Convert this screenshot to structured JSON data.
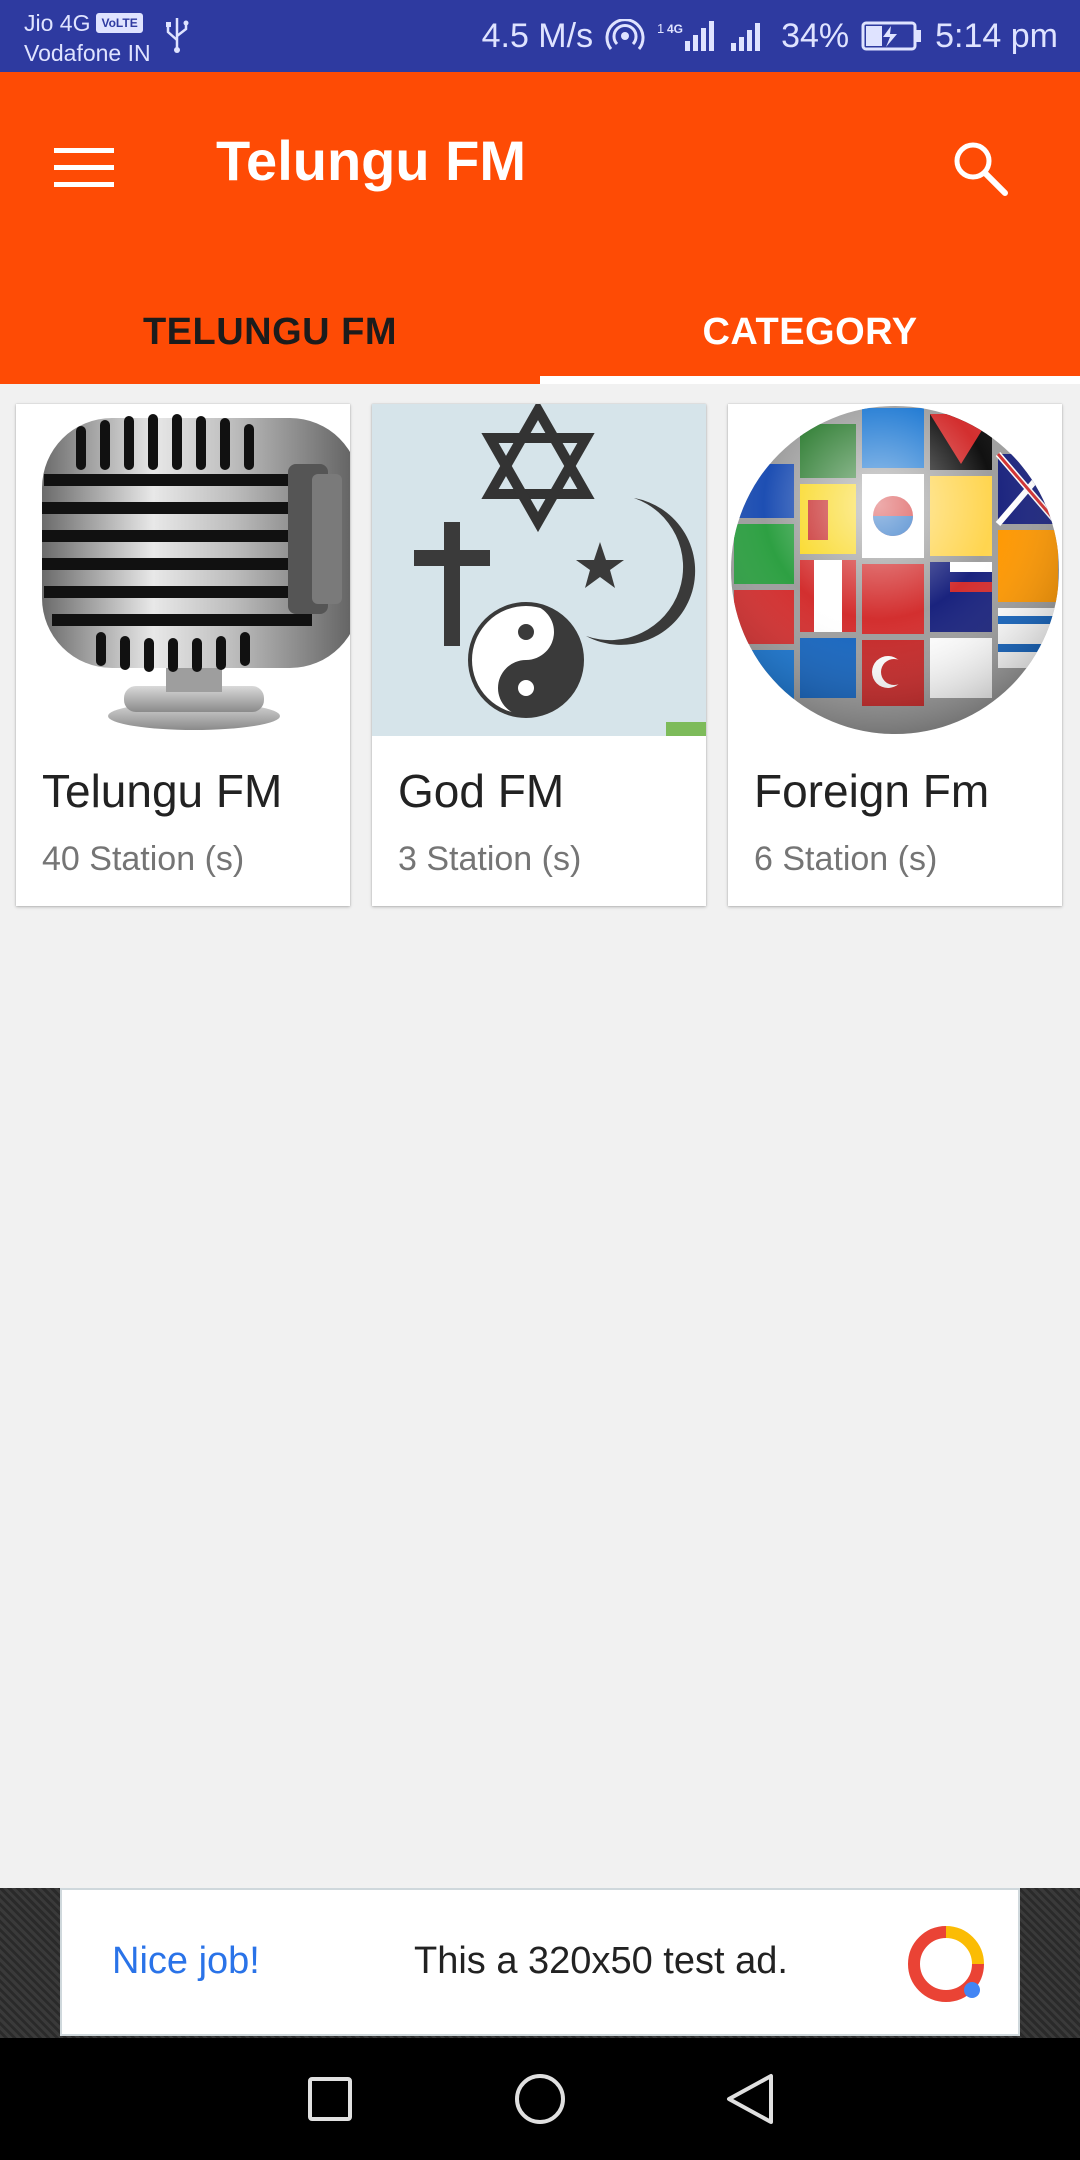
{
  "status_bar": {
    "carrier_1": "Jio 4G",
    "volte": "VoLTE",
    "carrier_2": "Vodafone IN",
    "speed": "4.5 M/s",
    "network_type": "4G",
    "battery": "34%",
    "time": "5:14 pm"
  },
  "app_bar": {
    "title": "Telungu FM",
    "accent": "#fe4b05"
  },
  "tabs": [
    {
      "label": "TELUNGU FM",
      "selected": false
    },
    {
      "label": "CATEGORY",
      "selected": true
    }
  ],
  "categories": [
    {
      "title": "Telungu FM",
      "count": "40 Station (s)",
      "image": "microphone-image"
    },
    {
      "title": "God FM",
      "count": "3 Station (s)",
      "image": "religious-symbols-image"
    },
    {
      "title": "Foreign Fm",
      "count": "6 Station (s)",
      "image": "flag-globe-image"
    }
  ],
  "ad": {
    "highlight": "Nice job!",
    "text": "This a 320x50 test ad."
  },
  "nav": {
    "recents": "square-icon",
    "home": "circle-icon",
    "back": "triangle-back-icon"
  }
}
